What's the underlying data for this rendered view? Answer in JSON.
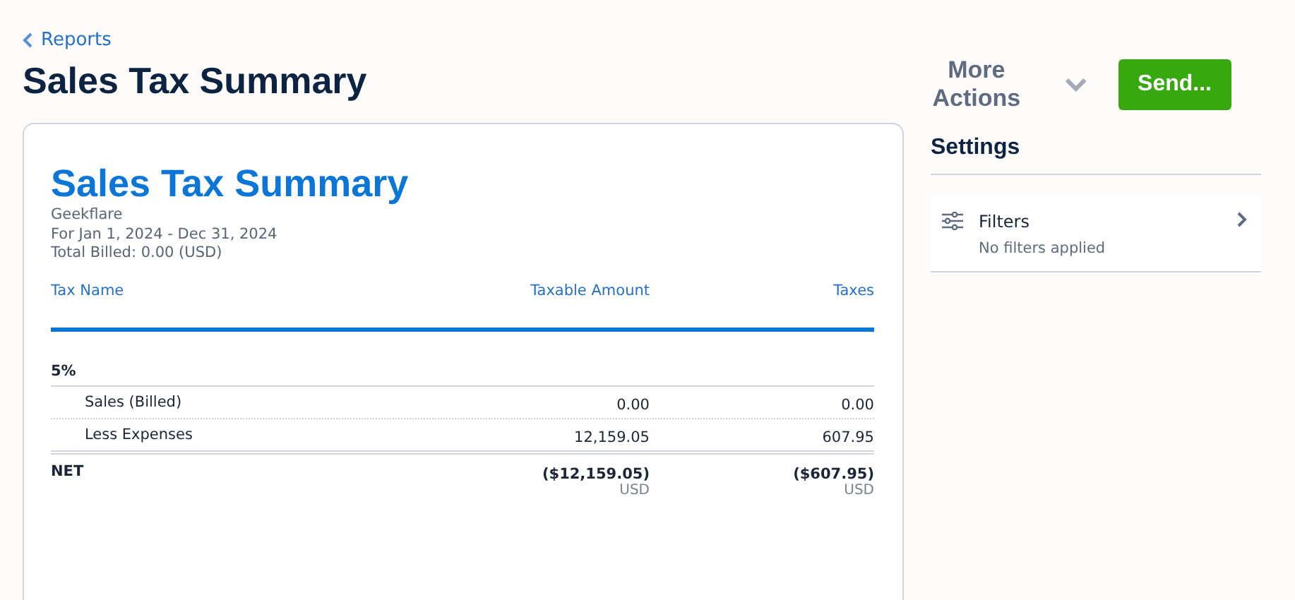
{
  "breadcrumb": {
    "label": "Reports"
  },
  "page_title": "Sales Tax Summary",
  "actions": {
    "more": "More Actions",
    "send": "Send..."
  },
  "report": {
    "title": "Sales Tax Summary",
    "company": "Geekflare",
    "period": "For Jan 1, 2024 - Dec 31, 2024",
    "total_billed": "Total Billed: 0.00 (USD)",
    "columns": [
      "Tax Name",
      "Taxable Amount",
      "Taxes"
    ],
    "rows": [
      {
        "kind": "group",
        "name": "5%"
      },
      {
        "kind": "item",
        "name": "Sales (Billed)",
        "taxable": "0.00",
        "taxes": "0.00"
      },
      {
        "kind": "item",
        "name": "Less Expenses",
        "taxable": "12,159.05",
        "taxes": "607.95"
      }
    ],
    "net": {
      "label": "NET",
      "taxable": "($12,159.05)",
      "taxable_currency": "USD",
      "taxes": "($607.95)",
      "taxes_currency": "USD"
    }
  },
  "settings": {
    "title": "Settings",
    "filters": {
      "label": "Filters",
      "summary": "No filters applied"
    }
  }
}
